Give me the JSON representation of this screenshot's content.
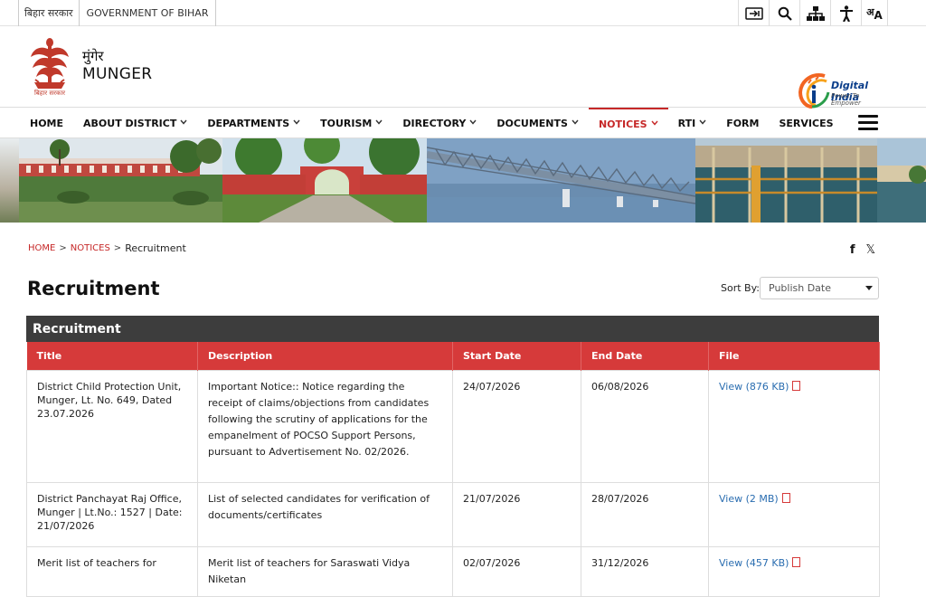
{
  "topbar": {
    "gov_hindi": "बिहार सरकार",
    "gov_english": "GOVERNMENT OF BIHAR",
    "tools": [
      {
        "icon": "skip-to-content-icon",
        "glyph": "⇥"
      },
      {
        "icon": "search-icon",
        "glyph": "🔍"
      },
      {
        "icon": "sitemap-icon",
        "glyph": "⊞"
      },
      {
        "icon": "accessibility-icon",
        "glyph": "♿"
      },
      {
        "icon": "language-icon",
        "glyph": "अA"
      }
    ]
  },
  "header": {
    "title_hindi": "मुंगेर",
    "title_english": "MUNGER",
    "emblem_caption": "बिहार सरकार",
    "digital_india": "Digital India",
    "digital_india_tag": "Power To Empower"
  },
  "nav": {
    "items": [
      {
        "label": "HOME",
        "dropdown": false
      },
      {
        "label": "ABOUT DISTRICT",
        "dropdown": true
      },
      {
        "label": "DEPARTMENTS",
        "dropdown": true
      },
      {
        "label": "TOURISM",
        "dropdown": true
      },
      {
        "label": "DIRECTORY",
        "dropdown": true
      },
      {
        "label": "DOCUMENTS",
        "dropdown": true
      },
      {
        "label": "NOTICES",
        "dropdown": true,
        "active": true
      },
      {
        "label": "RTI",
        "dropdown": true
      },
      {
        "label": "FORM",
        "dropdown": false
      },
      {
        "label": "SERVICES",
        "dropdown": false
      }
    ]
  },
  "breadcrumb": {
    "home": "HOME",
    "notices": "NOTICES",
    "current": "Recruitment",
    "sep": ">"
  },
  "share": {
    "facebook": "f",
    "x": "𝕏"
  },
  "page": {
    "title": "Recruitment",
    "sort_label": "Sort By:",
    "sort_value": "Publish Date"
  },
  "table": {
    "caption": "Recruitment",
    "headers": [
      "Title",
      "Description",
      "Start Date",
      "End Date",
      "File"
    ],
    "rows": [
      {
        "title": "District Child Protection Unit, Munger, Lt. No. 649, Dated 23.07.2026",
        "description": "Important Notice:: Notice regarding the receipt of claims/objections from candidates following the scrutiny of applications for the empanelment of POCSO Support Persons, pursuant to Advertisement No. 02/2026.",
        "start": "24/07/2026",
        "end": "06/08/2026",
        "file": "View (876 KB)"
      },
      {
        "title": "District Panchayat Raj Office, Munger | Lt.No.: 1527 | Date: 21/07/2026",
        "description": "List of selected candidates for verification of documents/certificates",
        "start": "21/07/2026",
        "end": "28/07/2026",
        "file": "View (2 MB)"
      },
      {
        "title": "Merit list of teachers for",
        "description": "Merit list of teachers for Saraswati Vidya Niketan",
        "start": "02/07/2026",
        "end": "31/12/2026",
        "file": "View (457 KB)"
      }
    ]
  },
  "colors": {
    "accent": "#d63a3a",
    "caption_bg": "#3d3d3d",
    "link": "#2a6db0"
  }
}
